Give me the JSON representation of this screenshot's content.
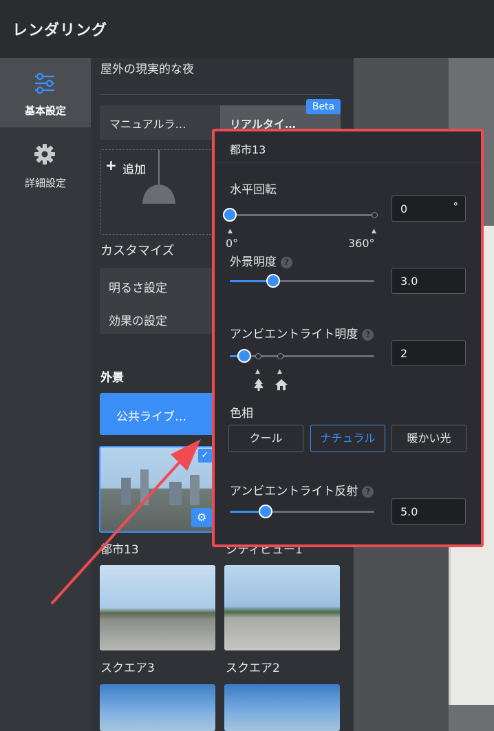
{
  "window": {
    "title": "レンダリング"
  },
  "sidebar": {
    "items": [
      {
        "label": "基本設定",
        "icon": "sliders-icon",
        "active": true
      },
      {
        "label": "詳細設定",
        "icon": "gear-icon",
        "active": false
      }
    ]
  },
  "panel": {
    "preset_name": "屋外の現実的な夜",
    "light_modes": [
      {
        "label": "マニュアルラ…"
      },
      {
        "label": "リアルタイ…",
        "badge": "Beta"
      }
    ],
    "add_label": "追加",
    "customize": {
      "title": "カスタマイズ",
      "items": [
        "明るさ設定",
        "効果の設定"
      ]
    },
    "exterior": {
      "title": "外景",
      "library_button": "公共ライブ…",
      "thumbnails": [
        {
          "label": "都市13",
          "selected": true
        },
        {
          "label": "シティビュー1",
          "selected": false
        },
        {
          "label": "スクエア3",
          "selected": false
        },
        {
          "label": "スクエア2",
          "selected": false
        },
        {
          "label": "",
          "selected": false
        },
        {
          "label": "",
          "selected": false
        }
      ]
    }
  },
  "popover": {
    "title": "都市13",
    "rotation": {
      "label": "水平回転",
      "value": "0",
      "unit": "°",
      "min_label": "0°",
      "max_label": "360°",
      "fraction": 0.0
    },
    "exterior_brightness": {
      "label": "外景明度",
      "value": "3.0",
      "fraction": 0.3
    },
    "ambient_brightness": {
      "label": "アンビエントライト明度",
      "value": "2",
      "fraction": 0.1
    },
    "hue": {
      "label": "色相",
      "options": [
        "クール",
        "ナチュラル",
        "暖かい光"
      ],
      "selected": "ナチュラル"
    },
    "ambient_reflection": {
      "label": "アンビエントライト反射",
      "value": "5.0",
      "fraction": 0.25
    }
  },
  "colors": {
    "accent": "#3a8ef6",
    "highlight": "#f04b51",
    "panel_bg": "#2f3236",
    "popover_bg": "#2a2c31"
  }
}
